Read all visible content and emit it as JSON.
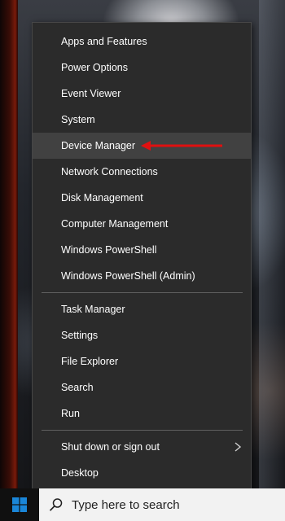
{
  "menu": {
    "items": [
      {
        "label": "Apps and Features"
      },
      {
        "label": "Power Options"
      },
      {
        "label": "Event Viewer"
      },
      {
        "label": "System"
      },
      {
        "label": "Device Manager"
      },
      {
        "label": "Network Connections"
      },
      {
        "label": "Disk Management"
      },
      {
        "label": "Computer Management"
      },
      {
        "label": "Windows PowerShell"
      },
      {
        "label": "Windows PowerShell (Admin)"
      },
      {
        "label": "Task Manager"
      },
      {
        "label": "Settings"
      },
      {
        "label": "File Explorer"
      },
      {
        "label": "Search"
      },
      {
        "label": "Run"
      },
      {
        "label": "Shut down or sign out"
      },
      {
        "label": "Desktop"
      }
    ],
    "hovered": "Device Manager",
    "submenu_icon": "chevron-right-icon"
  },
  "annotation": {
    "icon": "red-arrow-icon",
    "color": "#e01010"
  },
  "taskbar": {
    "start_icon": "windows-logo-icon",
    "search_icon": "search-icon",
    "search_placeholder": "Type here to search"
  },
  "colors": {
    "menu_bg": "#2b2b2b",
    "menu_hover": "#414141",
    "windows_blue": "#1a86d8"
  }
}
